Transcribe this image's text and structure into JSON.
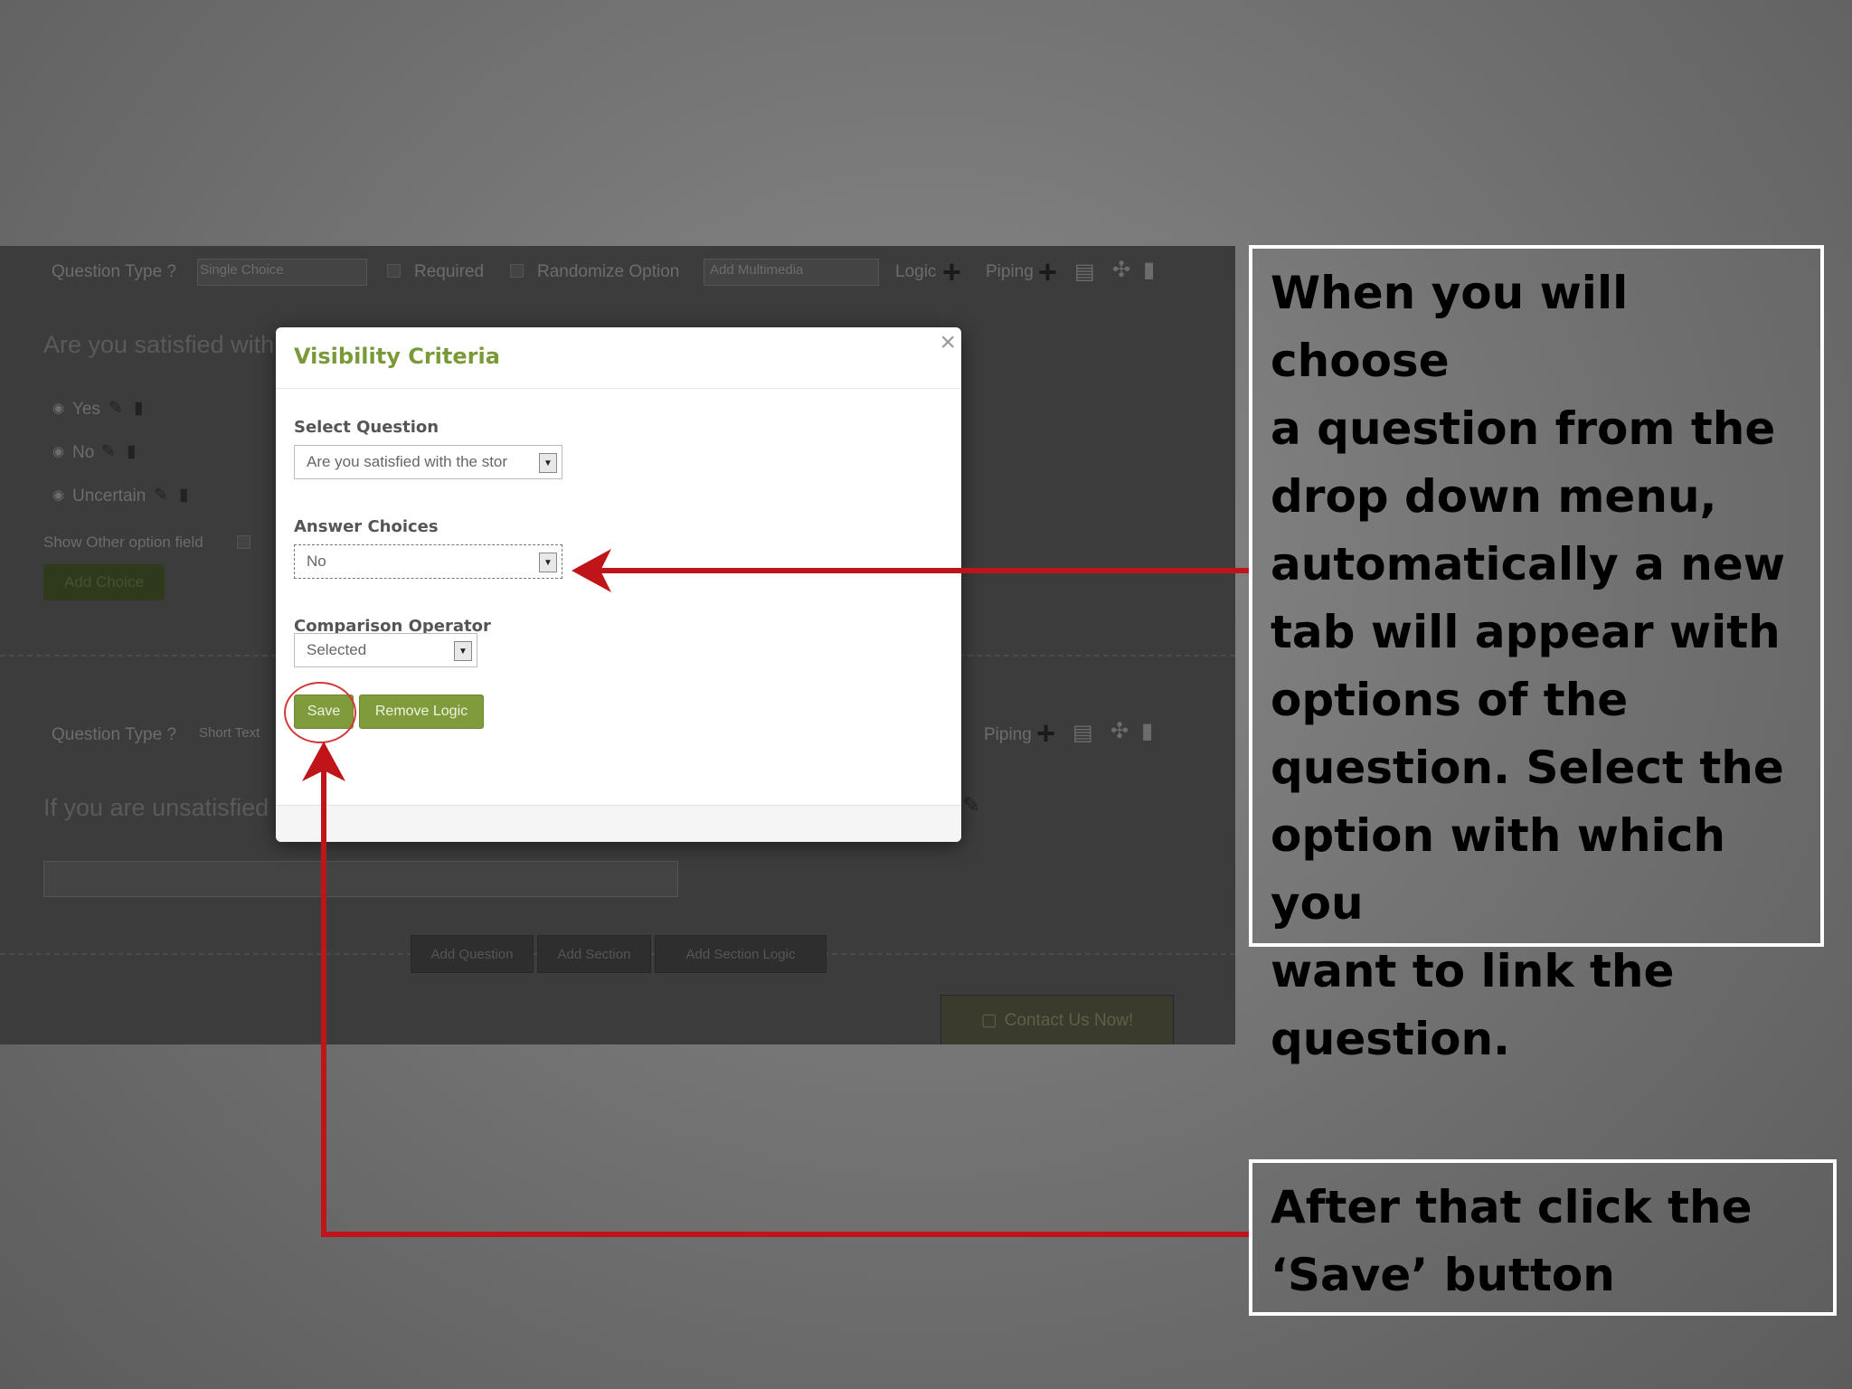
{
  "background_page": {
    "top_row": {
      "question_type_label": "Question Type ?",
      "question_type_value": "Single Choice",
      "required_label": "Required",
      "randomize_label": "Randomize Option",
      "multimedia_value": "Add Multimedia",
      "logic_label": "Logic",
      "piping_label": "Piping"
    },
    "question1": "Are you satisfied with",
    "choices": [
      "Yes",
      "No",
      "Uncertain"
    ],
    "show_other_label": "Show Other option field",
    "add_choice_label": "Add Choice",
    "second_row": {
      "question_type_label": "Question Type ?",
      "question_type_value": "Short Text",
      "piping_label": "Piping"
    },
    "question2": "If you are unsatisfied",
    "bottom_buttons": [
      "Add Question",
      "Add Section",
      "Add Section Logic"
    ],
    "contact_label": "Contact Us Now!"
  },
  "modal": {
    "title": "Visibility Criteria",
    "close_glyph": "×",
    "select_question_label": "Select Question",
    "select_question_value": "Are you satisfied with the stor",
    "answer_choices_label": "Answer Choices",
    "answer_choices_value": "No",
    "comparison_label": "Comparison Operator",
    "comparison_value": "Selected",
    "save_label": "Save",
    "remove_logic_label": "Remove Logic"
  },
  "callouts": {
    "top": [
      "When you will choose",
      "a question from the",
      "drop down menu,",
      "automatically a new",
      "tab will appear with",
      "options of the",
      "question. Select the",
      "option with which you",
      "want to link the",
      "question."
    ],
    "bottom": [
      "After that click the",
      "‘Save’ button"
    ]
  },
  "colors": {
    "accent_olive": "#7f9b3c",
    "title_green": "#7a9a3a",
    "arrow_red": "#c0141b"
  },
  "icons": {
    "dropdown": "▼",
    "plus": "+",
    "pencil": "pencil-icon",
    "trash": "trash-icon"
  }
}
